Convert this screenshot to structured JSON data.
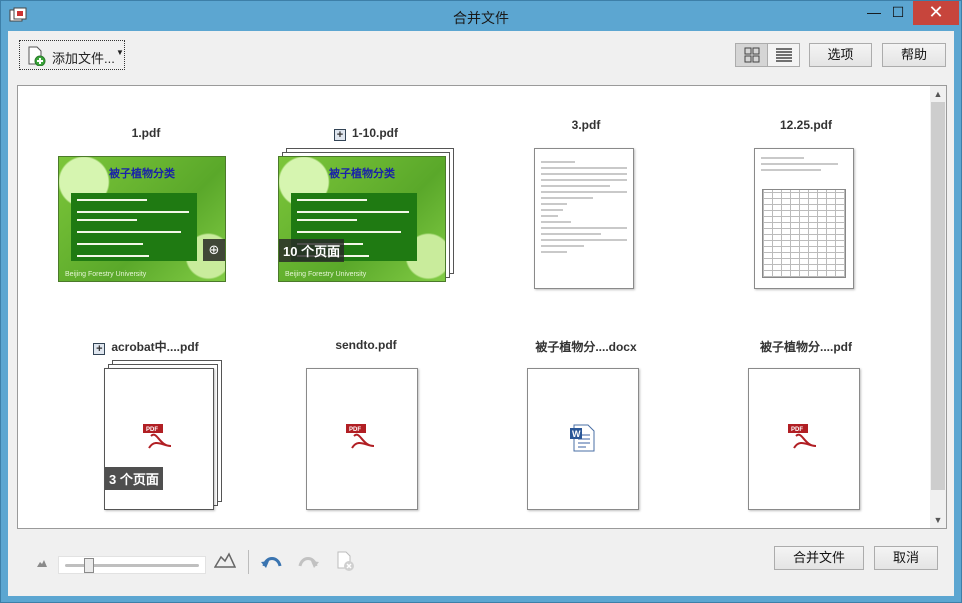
{
  "window": {
    "title": "合并文件",
    "minimize": "—",
    "maximize": "☐",
    "close": "✕"
  },
  "toolbar": {
    "add_files_label": "添加文件...",
    "options_label": "选项",
    "help_label": "帮助"
  },
  "files": [
    {
      "name": "1.pdf",
      "kind": "slide",
      "stacked": false,
      "slide_title": "被子植物分类",
      "footer": "Beijing Forestry University"
    },
    {
      "name": "1-10.pdf",
      "kind": "slide",
      "stacked": true,
      "expandable": true,
      "page_count": "10 个页面",
      "slide_title": "被子植物分类",
      "footer": "Beijing Forestry University"
    },
    {
      "name": "3.pdf",
      "kind": "document"
    },
    {
      "name": "12.25.pdf",
      "kind": "table"
    },
    {
      "name": "acrobat中....pdf",
      "kind": "pdf",
      "stacked": true,
      "expandable": true,
      "page_count": "3 个页面"
    },
    {
      "name": "sendto.pdf",
      "kind": "pdf"
    },
    {
      "name": "被子植物分....docx",
      "kind": "word"
    },
    {
      "name": "被子植物分....pdf",
      "kind": "pdf"
    }
  ],
  "slide_lines": [
    "一、分类的任务和意义:",
    "(1) 将植物分门别类、鉴定到种，解决如何识别植物的问题。",
    "(2) 建立反映植物亲缘关系的分类系统。",
    "(3) 相关学科的基础。",
    "(4) 是好的认识利用植物。"
  ],
  "bottom": {
    "zoom_level": 0.15,
    "merge_label": "合并文件",
    "cancel_label": "取消"
  },
  "icons": {
    "app": "app-icon",
    "add": "add-file-icon",
    "grid": "grid-view-icon",
    "list": "list-view-icon",
    "zoom": "zoom-in-icon",
    "pdf": "pdf-file-icon",
    "word": "word-file-icon",
    "small_mountain": "thumbnail-small-icon",
    "large_mountain": "thumbnail-large-icon",
    "undo": "undo-icon",
    "redo": "redo-icon",
    "remove": "remove-icon"
  },
  "colors": {
    "titlebar": "#5ca6d1",
    "close": "#c7453c",
    "slide_green": "#5aa82a",
    "pdf_red": "#b11f24"
  }
}
